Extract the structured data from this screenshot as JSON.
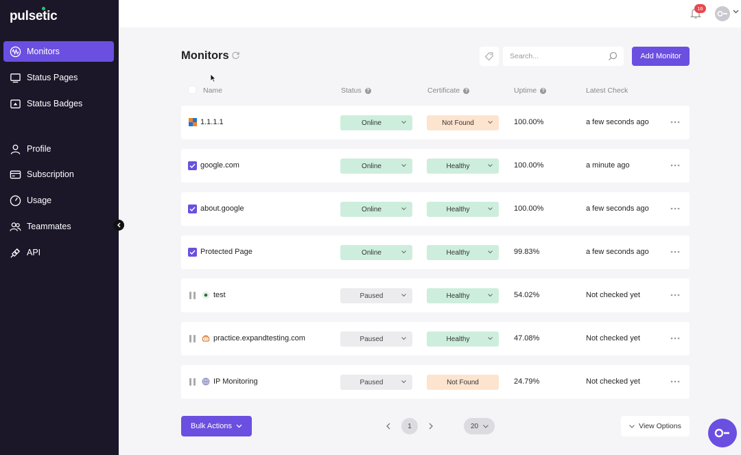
{
  "brand": {
    "name": "pulsetic"
  },
  "sidebar": {
    "items": [
      {
        "label": "Monitors",
        "icon": "monitors-icon",
        "active": true
      },
      {
        "label": "Status Pages",
        "icon": "status-pages-icon"
      },
      {
        "label": "Status Badges",
        "icon": "status-badges-icon"
      },
      {
        "label": "Profile",
        "icon": "profile-icon"
      },
      {
        "label": "Subscription",
        "icon": "subscription-icon"
      },
      {
        "label": "Usage",
        "icon": "usage-icon"
      },
      {
        "label": "Teammates",
        "icon": "teammates-icon"
      },
      {
        "label": "API",
        "icon": "api-icon"
      }
    ]
  },
  "topbar": {
    "notification_count": "16"
  },
  "page": {
    "title": "Monitors",
    "search_placeholder": "Search...",
    "add_label": "Add Monitor"
  },
  "table": {
    "headers": {
      "name": "Name",
      "status": "Status",
      "certificate": "Certificate",
      "uptime": "Uptime",
      "latest": "Latest Check"
    },
    "rows": [
      {
        "name": "1.1.1.1",
        "status": "Online",
        "certificate": "Not Found",
        "uptime": "100.00%",
        "latest": "a few seconds ago"
      },
      {
        "name": "google.com",
        "status": "Online",
        "certificate": "Healthy",
        "uptime": "100.00%",
        "latest": "a minute ago"
      },
      {
        "name": "about.google",
        "status": "Online",
        "certificate": "Healthy",
        "uptime": "100.00%",
        "latest": "a few seconds ago"
      },
      {
        "name": "Protected Page",
        "status": "Online",
        "certificate": "Healthy",
        "uptime": "99.83%",
        "latest": "a few seconds ago"
      },
      {
        "name": "test",
        "status": "Paused",
        "certificate": "Healthy",
        "uptime": "54.02%",
        "latest": "Not checked yet"
      },
      {
        "name": "practice.expandtesting.com",
        "status": "Paused",
        "certificate": "Healthy",
        "uptime": "47.08%",
        "latest": "Not checked yet"
      },
      {
        "name": "IP Monitoring",
        "status": "Paused",
        "certificate": "Not Found",
        "uptime": "24.79%",
        "latest": "Not checked yet"
      }
    ]
  },
  "footer": {
    "bulk_label": "Bulk Actions",
    "current_page": "1",
    "per_page": "20",
    "view_options_label": "View Options"
  },
  "colors": {
    "accent": "#6b4fe0",
    "sidebar_bg": "#1b1729",
    "online": "#cdeedc",
    "not_found": "#fde4cf",
    "paused": "#ececee"
  }
}
